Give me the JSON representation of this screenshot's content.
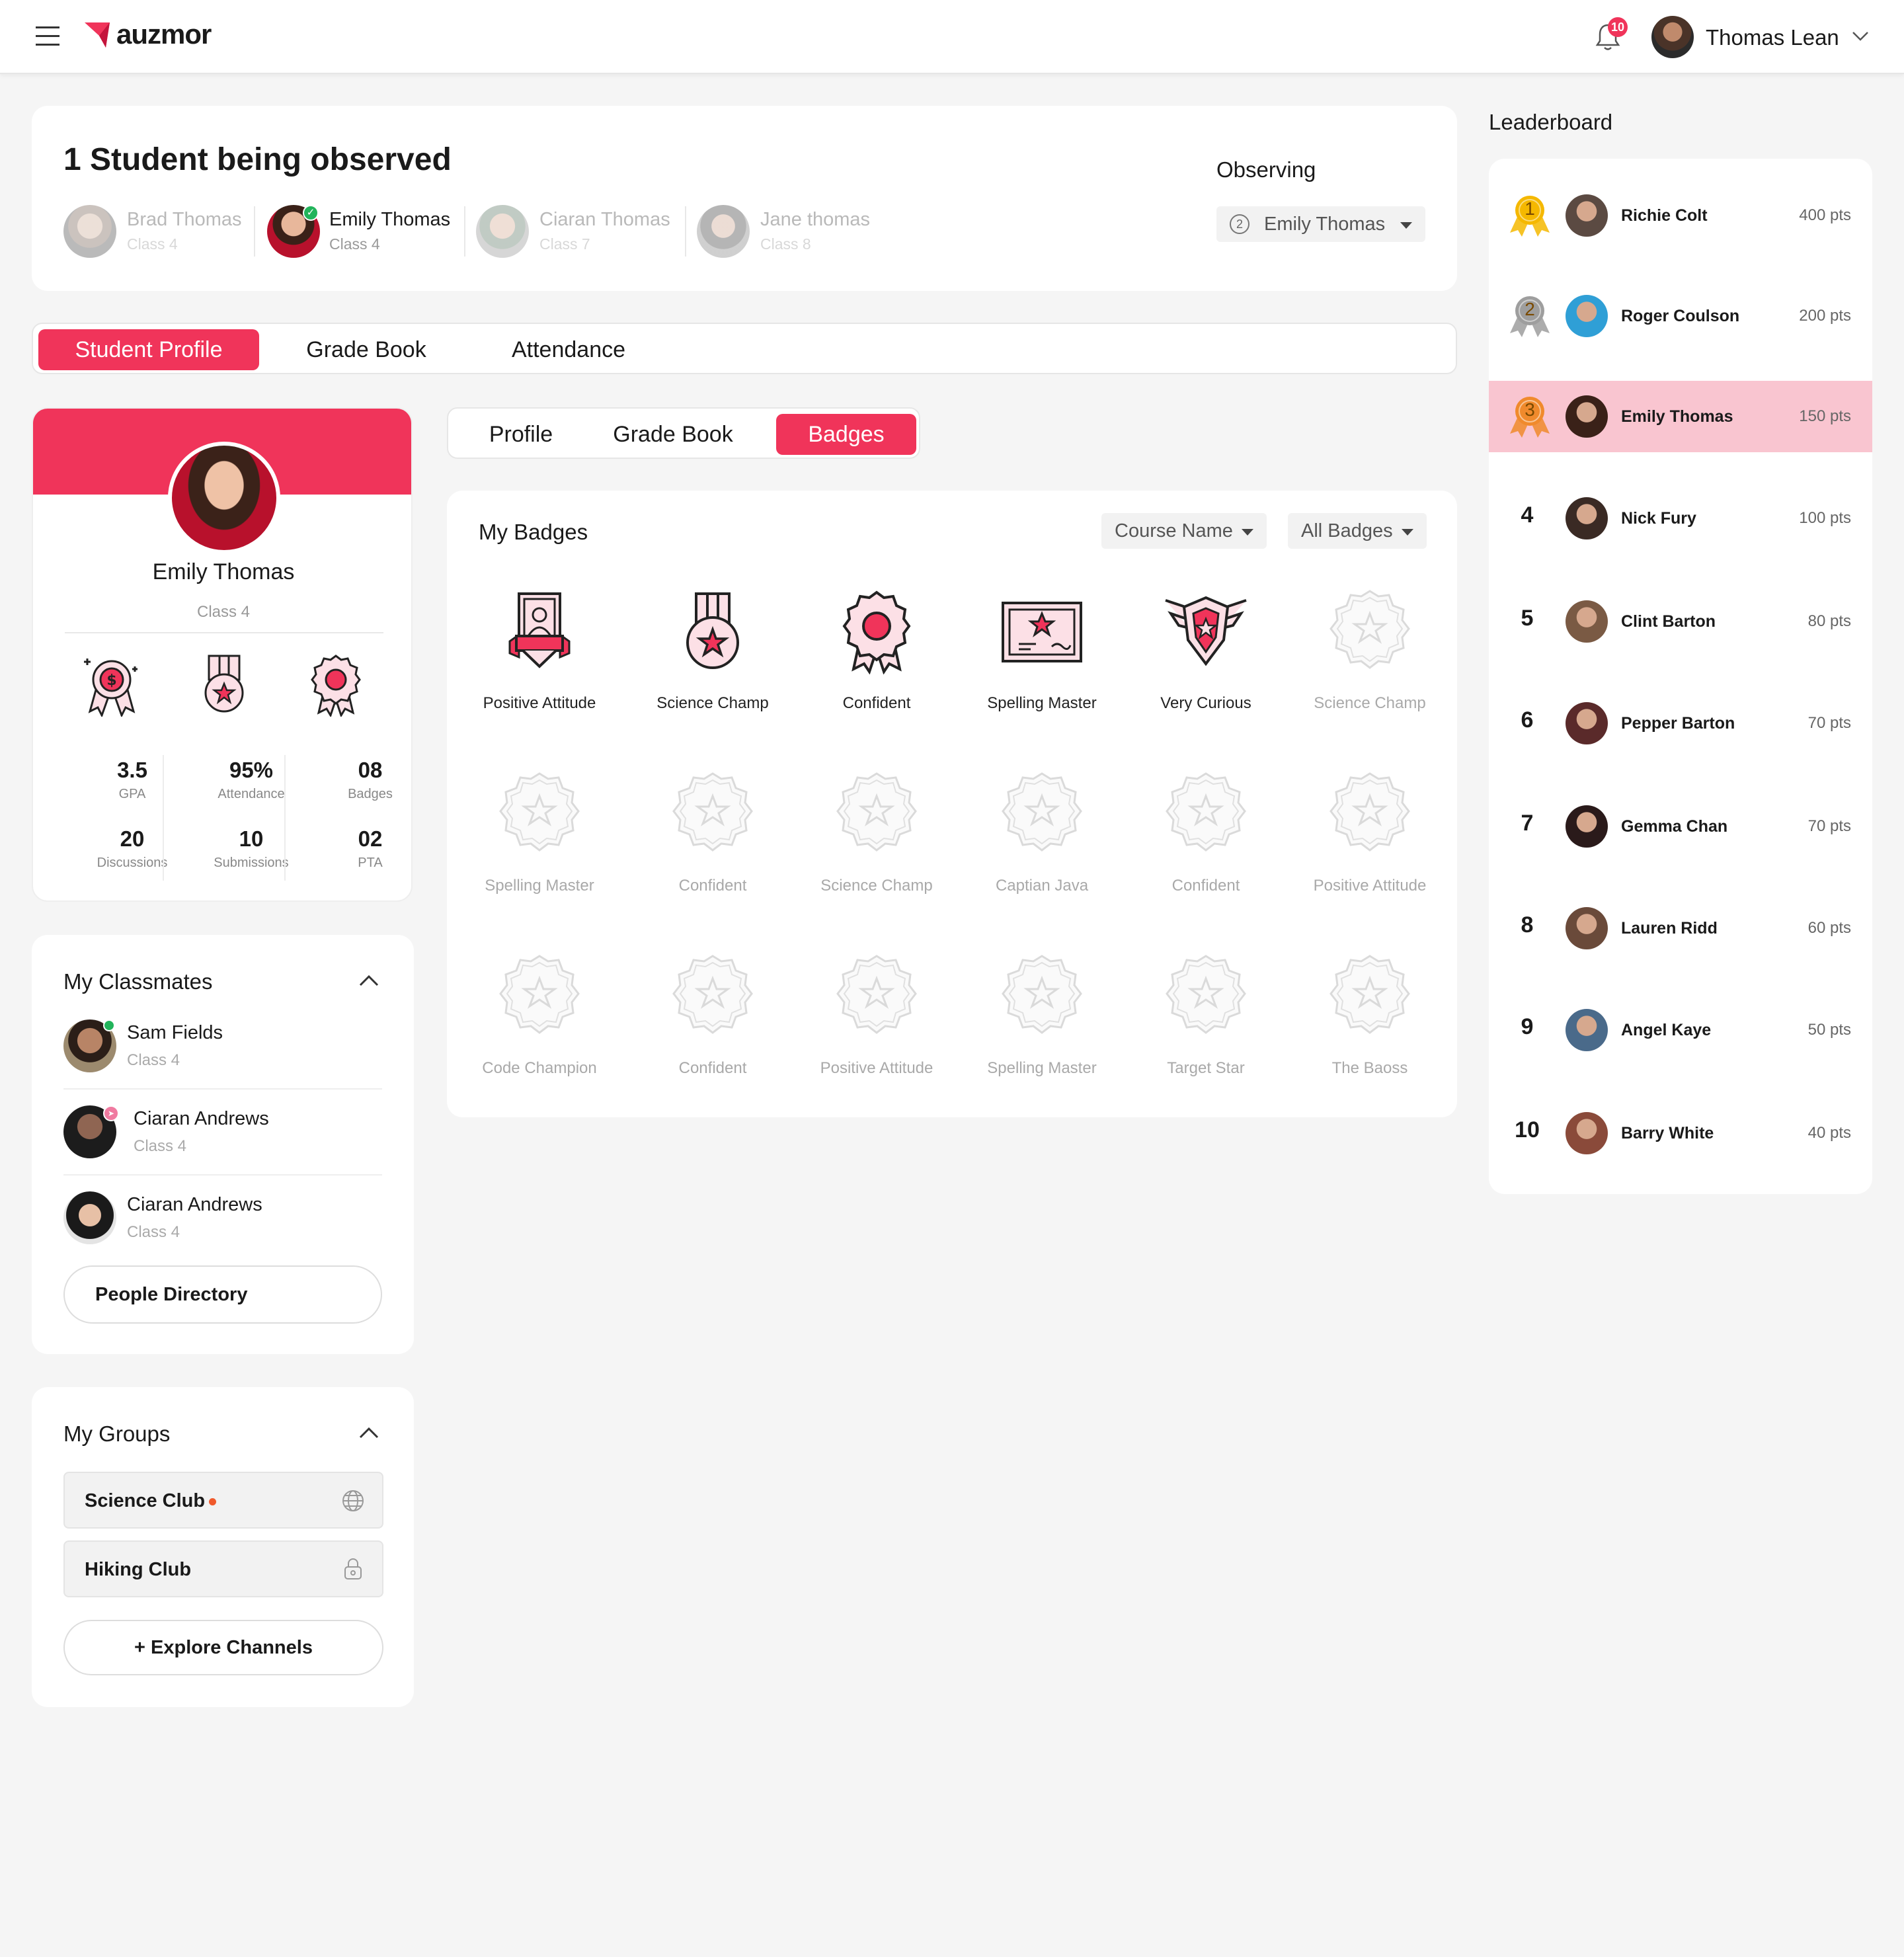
{
  "header": {
    "brand": "auzmor",
    "notif_count": "10",
    "user_name": "Thomas Lean"
  },
  "observed": {
    "title": "1 Student being observed",
    "observing_label": "Observing",
    "observing_select": "Emily Thomas",
    "observing_select_num": "2",
    "students": [
      {
        "name": "Brad Thomas",
        "class": "Class 4"
      },
      {
        "name": "Emily Thomas",
        "class": "Class 4"
      },
      {
        "name": "Ciaran Thomas",
        "class": "Class 7"
      },
      {
        "name": "Jane thomas",
        "class": "Class 8"
      }
    ]
  },
  "main_tabs": [
    "Student Profile",
    "Grade Book",
    "Attendance"
  ],
  "sub_tabs": [
    "Profile",
    "Grade Book",
    "Badges"
  ],
  "profile": {
    "name": "Emily Thomas",
    "class": "Class 4",
    "stats": [
      {
        "value": "3.5",
        "label": "GPA"
      },
      {
        "value": "95%",
        "label": "Attendance"
      },
      {
        "value": "08",
        "label": "Badges"
      },
      {
        "value": "20",
        "label": "Discussions"
      },
      {
        "value": "10",
        "label": "Submissions"
      },
      {
        "value": "02",
        "label": "PTA"
      }
    ]
  },
  "badges": {
    "title": "My Badges",
    "filter_course": "Course Name",
    "filter_badges": "All Badges",
    "items": [
      {
        "label": "Positive Attitude",
        "earned": true,
        "icon": "certificate-badge-icon"
      },
      {
        "label": "Science Champ",
        "earned": true,
        "icon": "medal-star-icon"
      },
      {
        "label": "Confident",
        "earned": true,
        "icon": "rosette-icon"
      },
      {
        "label": "Spelling Master",
        "earned": true,
        "icon": "diploma-icon"
      },
      {
        "label": "Very Curious",
        "earned": true,
        "icon": "winged-shield-icon"
      },
      {
        "label": "Science Champ",
        "earned": false
      },
      {
        "label": "Spelling Master",
        "earned": false
      },
      {
        "label": "Confident",
        "earned": false
      },
      {
        "label": "Science Champ",
        "earned": false
      },
      {
        "label": "Captian Java",
        "earned": false
      },
      {
        "label": "Confident",
        "earned": false
      },
      {
        "label": "Positive Attitude",
        "earned": false
      },
      {
        "label": "Code Champion",
        "earned": false
      },
      {
        "label": "Confident",
        "earned": false
      },
      {
        "label": "Positive Attitude",
        "earned": false
      },
      {
        "label": "Spelling Master",
        "earned": false
      },
      {
        "label": "Target Star",
        "earned": false
      },
      {
        "label": "The Baoss",
        "earned": false
      }
    ]
  },
  "classmates": {
    "title": "My Classmates",
    "items": [
      {
        "name": "Sam Fields",
        "class": "Class 4"
      },
      {
        "name": "Ciaran Andrews",
        "class": "Class 4"
      },
      {
        "name": "Ciaran Andrews",
        "class": "Class 4"
      }
    ],
    "button": "People Directory"
  },
  "groups": {
    "title": "My Groups",
    "items": [
      {
        "name": "Science Club",
        "icon": "globe-icon"
      },
      {
        "name": "Hiking Club",
        "icon": "lock-icon"
      }
    ],
    "button": "+ Explore Channels"
  },
  "leaderboard": {
    "title": "Leaderboard",
    "rows": [
      {
        "rank": "1",
        "name": "Richie Colt",
        "pts": "400 pts"
      },
      {
        "rank": "2",
        "name": "Roger Coulson",
        "pts": "200 pts"
      },
      {
        "rank": "3",
        "name": "Emily Thomas",
        "pts": "150 pts"
      },
      {
        "rank": "4",
        "name": "Nick Fury",
        "pts": "100 pts"
      },
      {
        "rank": "5",
        "name": "Clint Barton",
        "pts": "80 pts"
      },
      {
        "rank": "6",
        "name": "Pepper Barton",
        "pts": "70 pts"
      },
      {
        "rank": "7",
        "name": "Gemma Chan",
        "pts": "70 pts"
      },
      {
        "rank": "8",
        "name": "Lauren Ridd",
        "pts": "60 pts"
      },
      {
        "rank": "9",
        "name": "Angel Kaye",
        "pts": "50 pts"
      },
      {
        "rank": "10",
        "name": "Barry White",
        "pts": "40 pts"
      }
    ]
  },
  "colors": {
    "accent": "#f0345a",
    "highlight": "#f9c5d0",
    "gold": "#f5b800",
    "silver": "#9e9e9e",
    "bronze": "#f08a2c"
  }
}
